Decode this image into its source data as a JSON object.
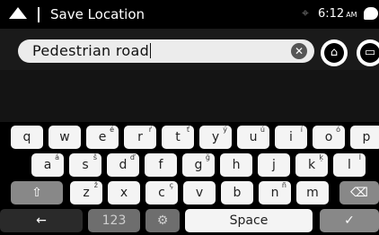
{
  "header": {
    "title": "Save Location",
    "time": "6:12",
    "ampm": "AM"
  },
  "search": {
    "value": "Pedestrian road"
  },
  "icons": {
    "back": "back-icon",
    "gps": "gps-off-icon",
    "message": "message-icon",
    "clear": "clear-icon",
    "home": "home-icon",
    "save": "briefcase-icon",
    "shift": "shift-icon",
    "backspace": "backspace-icon",
    "left_arrow": "arrow-left-icon",
    "settings": "settings-icon",
    "confirm": "checkmark-icon"
  },
  "keyboard": {
    "row1": [
      {
        "key": "q",
        "alt": ""
      },
      {
        "key": "w",
        "alt": ""
      },
      {
        "key": "e",
        "alt": "é"
      },
      {
        "key": "r",
        "alt": "ŕ"
      },
      {
        "key": "t",
        "alt": "ť"
      },
      {
        "key": "y",
        "alt": "ý"
      },
      {
        "key": "u",
        "alt": "ú"
      },
      {
        "key": "i",
        "alt": "í"
      },
      {
        "key": "o",
        "alt": "ó"
      },
      {
        "key": "p",
        "alt": ""
      }
    ],
    "row2": [
      {
        "key": "a",
        "alt": "á"
      },
      {
        "key": "s",
        "alt": "š"
      },
      {
        "key": "d",
        "alt": "ď"
      },
      {
        "key": "f",
        "alt": ""
      },
      {
        "key": "g",
        "alt": "ğ"
      },
      {
        "key": "h",
        "alt": ""
      },
      {
        "key": "j",
        "alt": ""
      },
      {
        "key": "k",
        "alt": "ķ"
      },
      {
        "key": "l",
        "alt": "ĺ"
      }
    ],
    "row3": [
      {
        "key": "z",
        "alt": "ž"
      },
      {
        "key": "x",
        "alt": ""
      },
      {
        "key": "c",
        "alt": "ç"
      },
      {
        "key": "v",
        "alt": ""
      },
      {
        "key": "b",
        "alt": ""
      },
      {
        "key": "n",
        "alt": "ñ"
      },
      {
        "key": "m",
        "alt": ""
      }
    ],
    "numbers_label": "123",
    "space_label": "Space",
    "shift_glyph": "⇧",
    "backspace_glyph": "⌫",
    "left_glyph": "←",
    "settings_glyph": "⚙",
    "confirm_glyph": "✓"
  },
  "colors": {
    "key_light": "#f4f4f4",
    "key_gray": "#888888",
    "key_dark": "#2a2a2a"
  }
}
